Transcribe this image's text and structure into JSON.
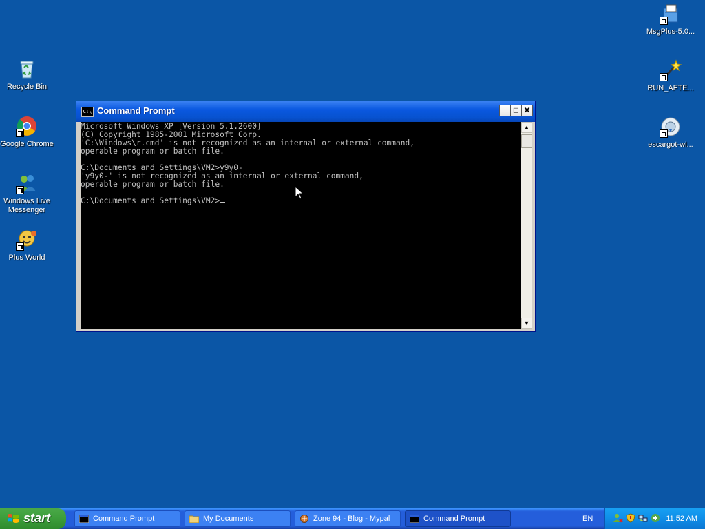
{
  "desktop": {
    "icons": [
      {
        "label": "Recycle Bin"
      },
      {
        "label": "Google Chrome"
      },
      {
        "label": "Windows Live Messenger"
      },
      {
        "label": "Plus World"
      },
      {
        "label": "MsgPlus-5.0..."
      },
      {
        "label": "RUN_AFTE..."
      },
      {
        "label": "escargot-wl..."
      }
    ]
  },
  "window": {
    "title": "Command Prompt",
    "icon_text": "C:\\",
    "console_lines": [
      "Microsoft Windows XP [Version 5.1.2600]",
      "(C) Copyright 1985-2001 Microsoft Corp.",
      "'C:\\Windows\\r.cmd' is not recognized as an internal or external command,",
      "operable program or batch file.",
      "",
      "C:\\Documents and Settings\\VM2>y9y0-",
      "'y9y0-' is not recognized as an internal or external command,",
      "operable program or batch file.",
      "",
      "C:\\Documents and Settings\\VM2>"
    ]
  },
  "taskbar": {
    "start_label": "start",
    "items": [
      {
        "label": "Command Prompt"
      },
      {
        "label": "My Documents"
      },
      {
        "label": "Zone 94 - Blog - Mypal"
      },
      {
        "label": "Command Prompt"
      }
    ],
    "language": "EN",
    "clock": "11:52 AM"
  }
}
